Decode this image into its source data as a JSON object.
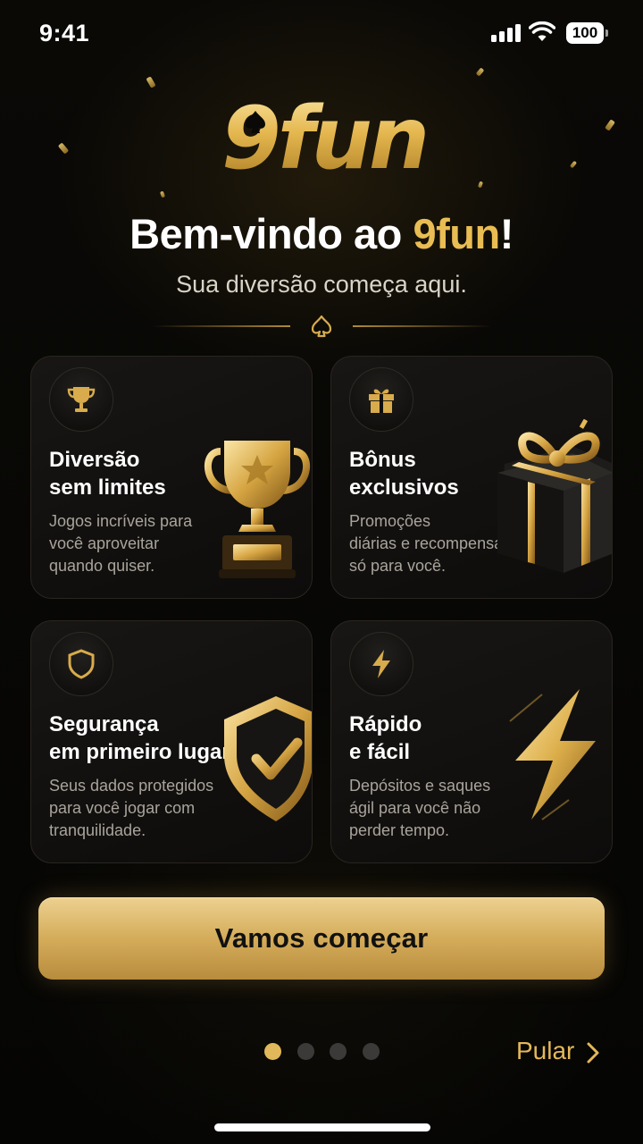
{
  "status_bar": {
    "time": "9:41",
    "battery": "100"
  },
  "logo": {
    "text": "9fun"
  },
  "welcome": {
    "title_prefix": "Bem-vindo ao ",
    "title_accent": "9fun",
    "title_suffix": "!",
    "subtitle": "Sua diversão começa aqui."
  },
  "cards": [
    {
      "title_line1": "Diversão",
      "title_line2": "sem limites",
      "desc_line1": "Jogos incríveis para",
      "desc_line2": "você aproveitar",
      "desc_line3": "quando quiser.",
      "icon": "trophy-icon"
    },
    {
      "title_line1": "Bônus",
      "title_line2": "exclusivos",
      "desc_line1": "Promoções",
      "desc_line2": "diárias e recompensas",
      "desc_line3": "só para você.",
      "icon": "gift-icon"
    },
    {
      "title_line1": "Segurança",
      "title_line2": "em primeiro lugar",
      "desc_line1": "Seus dados protegidos",
      "desc_line2": "para você jogar com",
      "desc_line3": "tranquilidade.",
      "icon": "shield-icon"
    },
    {
      "title_line1": "Rápido",
      "title_line2": "e fácil",
      "desc_line1": "Depósitos e saques",
      "desc_line2": "ágil para você não",
      "desc_line3": "perder tempo.",
      "icon": "lightning-icon"
    }
  ],
  "cta": {
    "label": "Vamos começar"
  },
  "pagination": {
    "current_page": 1,
    "total_pages": 4
  },
  "skip": {
    "label": "Pular"
  },
  "colors": {
    "gold": "#e1b85a",
    "background": "#070605",
    "card": "#141210"
  }
}
